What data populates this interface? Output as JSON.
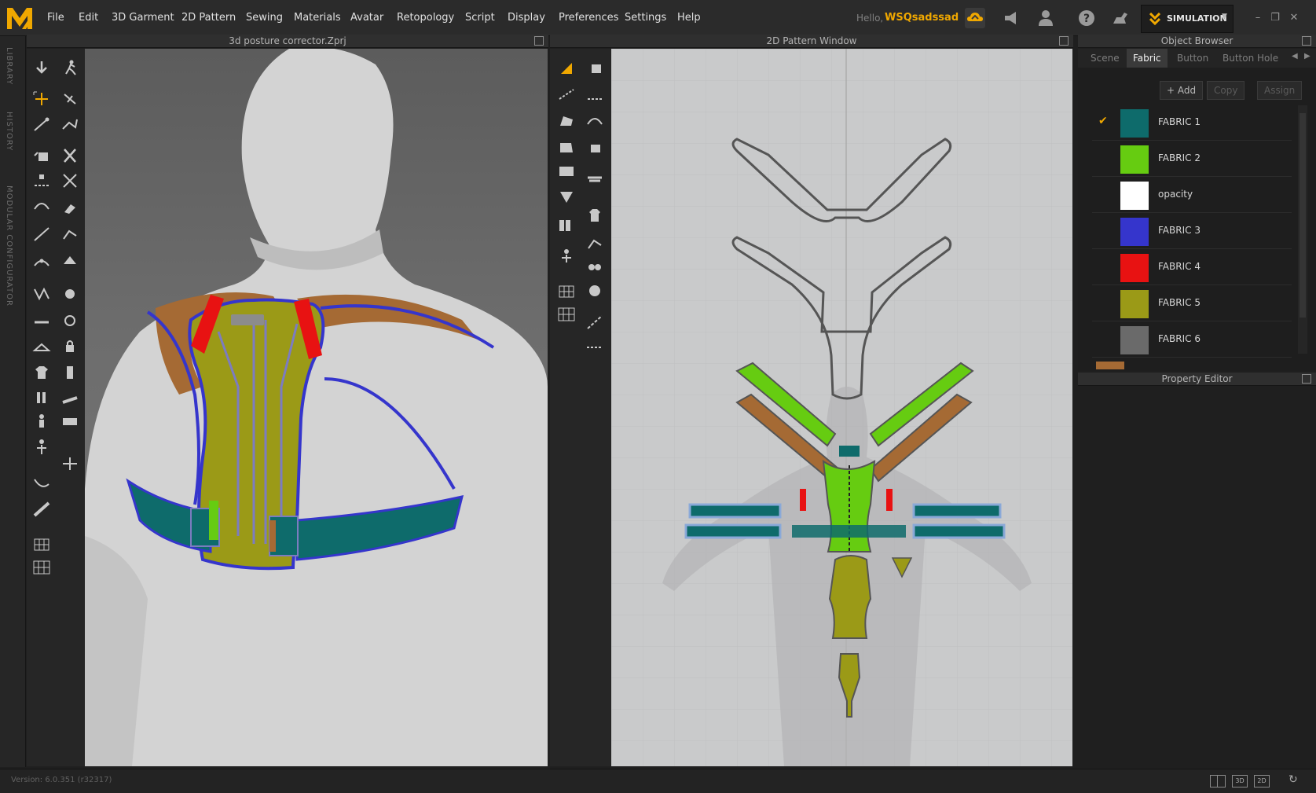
{
  "app": {
    "menu": [
      "File",
      "Edit",
      "3D Garment",
      "2D Pattern",
      "Sewing",
      "Materials",
      "Avatar",
      "Retopology",
      "Script",
      "Display",
      "Preferences",
      "Settings",
      "Help"
    ],
    "hello_text": "Hello,",
    "username": "WSQsadssad",
    "mode_label": "SIMULATION",
    "accent": "#f0a800"
  },
  "side_tabs": [
    "LIBRARY",
    "HISTORY",
    "MODULAR CONFIGURATOR"
  ],
  "panels": {
    "viewport_3d_title": "3d posture corrector.Zprj",
    "viewport_2d_title": "2D Pattern Window",
    "object_browser_title": "Object Browser",
    "property_editor_title": "Property Editor"
  },
  "object_browser": {
    "tabs": [
      "Scene",
      "Fabric",
      "Button",
      "Button Hole"
    ],
    "active_tab": "Fabric",
    "buttons": {
      "add": "+ Add",
      "copy": "Copy",
      "assign": "Assign"
    },
    "fabrics": [
      {
        "name": "FABRIC 1",
        "color": "#0e6b6b",
        "selected": true
      },
      {
        "name": "FABRIC 2",
        "color": "#66cc11",
        "selected": false
      },
      {
        "name": "opacity",
        "color": "#ffffff",
        "selected": false
      },
      {
        "name": "FABRIC 3",
        "color": "#3535cc",
        "selected": false
      },
      {
        "name": "FABRIC 4",
        "color": "#e81212",
        "selected": false
      },
      {
        "name": "FABRIC 5",
        "color": "#9b9a17",
        "selected": false
      },
      {
        "name": "FABRIC 6",
        "color": "#6a6a6a",
        "selected": false
      }
    ]
  },
  "status": {
    "version": "Version: 6.0.351 (r32317)"
  }
}
